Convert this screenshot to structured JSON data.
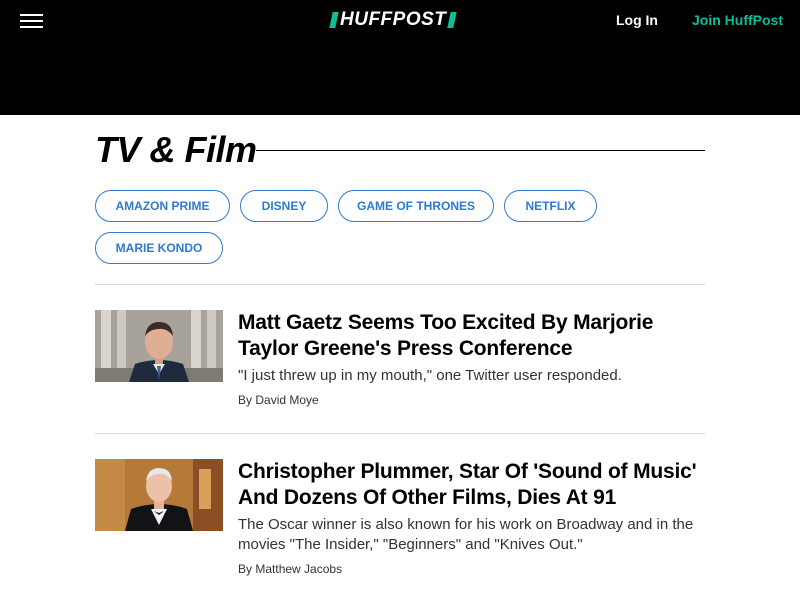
{
  "header": {
    "logo_text": "HUFFPOST",
    "login_label": "Log In",
    "join_label": "Join HuffPost",
    "accent_color": "#0dbe98"
  },
  "section": {
    "title": "TV & Film"
  },
  "tags": [
    "AMAZON PRIME",
    "DISNEY",
    "GAME OF THRONES",
    "NETFLIX",
    "MARIE KONDO"
  ],
  "articles": [
    {
      "headline": "Matt Gaetz Seems Too Excited By Marjorie Taylor Greene's Press Conference",
      "dek": "\"I just threw up in my mouth,\" one Twitter user responded.",
      "by": "By",
      "author": "David Moye",
      "image_icon": "portrait-photo"
    },
    {
      "headline": "Christopher Plummer, Star Of 'Sound of Music' And Dozens Of Other Films, Dies At 91",
      "dek": "The Oscar winner is also known for his work on Broadway and in the movies \"The Insider,\" \"Beginners\" and \"Knives Out.\"",
      "by": "By",
      "author": "Matthew Jacobs",
      "image_icon": "portrait-photo"
    }
  ]
}
